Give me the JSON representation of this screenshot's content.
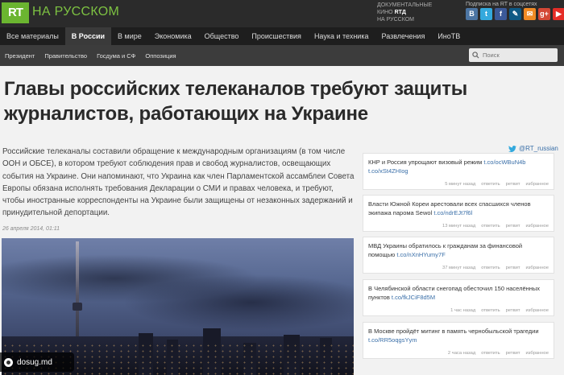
{
  "header": {
    "logo": "RT",
    "logo_sub": "НА РУССКОМ",
    "doc_line1": "Документальные",
    "doc_line2_prefix": "кино ",
    "doc_line2_accent": "RTД",
    "doc_line3": "на русском",
    "subscribe": "Подписка на RT в соцсетях",
    "social": [
      {
        "icon": "vk-icon",
        "glyph": "B",
        "color": "#4c75a3"
      },
      {
        "icon": "twitter-icon",
        "glyph": "t",
        "color": "#33a9dd"
      },
      {
        "icon": "facebook-icon",
        "glyph": "f",
        "color": "#3b5998"
      },
      {
        "icon": "livejournal-icon",
        "glyph": "✎",
        "color": "#0e5a85"
      },
      {
        "icon": "odnoklassniki-icon",
        "glyph": "✉",
        "color": "#f08a24"
      },
      {
        "icon": "google-plus-icon",
        "glyph": "g+",
        "color": "#d34836"
      },
      {
        "icon": "youtube-icon",
        "glyph": "▶",
        "color": "#e52d27"
      },
      {
        "icon": "rss-icon",
        "glyph": "☰",
        "color": "#c0392b"
      }
    ]
  },
  "nav": {
    "items": [
      {
        "label": "Все материалы",
        "active": false
      },
      {
        "label": "В России",
        "active": true
      },
      {
        "label": "В мире",
        "active": false
      },
      {
        "label": "Экономика",
        "active": false
      },
      {
        "label": "Общество",
        "active": false
      },
      {
        "label": "Происшествия",
        "active": false
      },
      {
        "label": "Наука и техника",
        "active": false
      },
      {
        "label": "Развлечения",
        "active": false
      },
      {
        "label": "ИноТВ",
        "active": false
      }
    ]
  },
  "subnav": {
    "items": [
      "Президент",
      "Правительство",
      "Госдума и СФ",
      "Оппозиция"
    ],
    "search_placeholder": "Поиск"
  },
  "article": {
    "title": "Главы российских телеканалов требуют защиты журналистов, работающих на Украине",
    "lead": "Российские телеканалы составили обращение к международным организациям (в том числе ООН и ОБСЕ), в котором требуют соблюдения прав и свобод журналистов, освещающих события на Украине. Они напоминают, что Украина как член Парламентской ассамблеи Совета Европы обязана исполнять требования Декларации о СМИ и правах человека, и требуют, чтобы иностранные корреспонденты на Украине были защищены от незаконных задержаний и принудительной депортации.",
    "date": "26 апреля 2014, 01:11"
  },
  "watermark": "dosug.md",
  "twitter": {
    "handle": "@RT_russian",
    "tweets": [
      {
        "text": "КНР и Россия упрощают визовый режим ",
        "url": "t.co/ocWBuN4b",
        "url2": "t.co/xSt4ZHIog",
        "time": "5 минут назад"
      },
      {
        "text": "Власти Южной Кореи арестовали всех спасшихся членов экипажа парома Sewol ",
        "url": "t.co/ndrEJt7f6l",
        "url2": "",
        "time": "13 минут назад"
      },
      {
        "text": "МВД Украины обратилось к гражданам за финансовой помощью ",
        "url": "t.co/nXnHYumy7F",
        "url2": "",
        "time": "37 минут назад"
      },
      {
        "text": "В Челябинской области снегопад обесточил 150 населённых пунктов ",
        "url": "t.co/fkJCiF8d5M",
        "url2": "",
        "time": "1 час назад"
      },
      {
        "text": "В Москве пройдёт митинг в память чернобыльской трагедии ",
        "url": "t.co/RR5oqgsYym",
        "url2": "",
        "time": "2 часа назад"
      }
    ],
    "action_reply": "ответить",
    "action_retweet": "ретвит",
    "action_fav": "избранное"
  }
}
